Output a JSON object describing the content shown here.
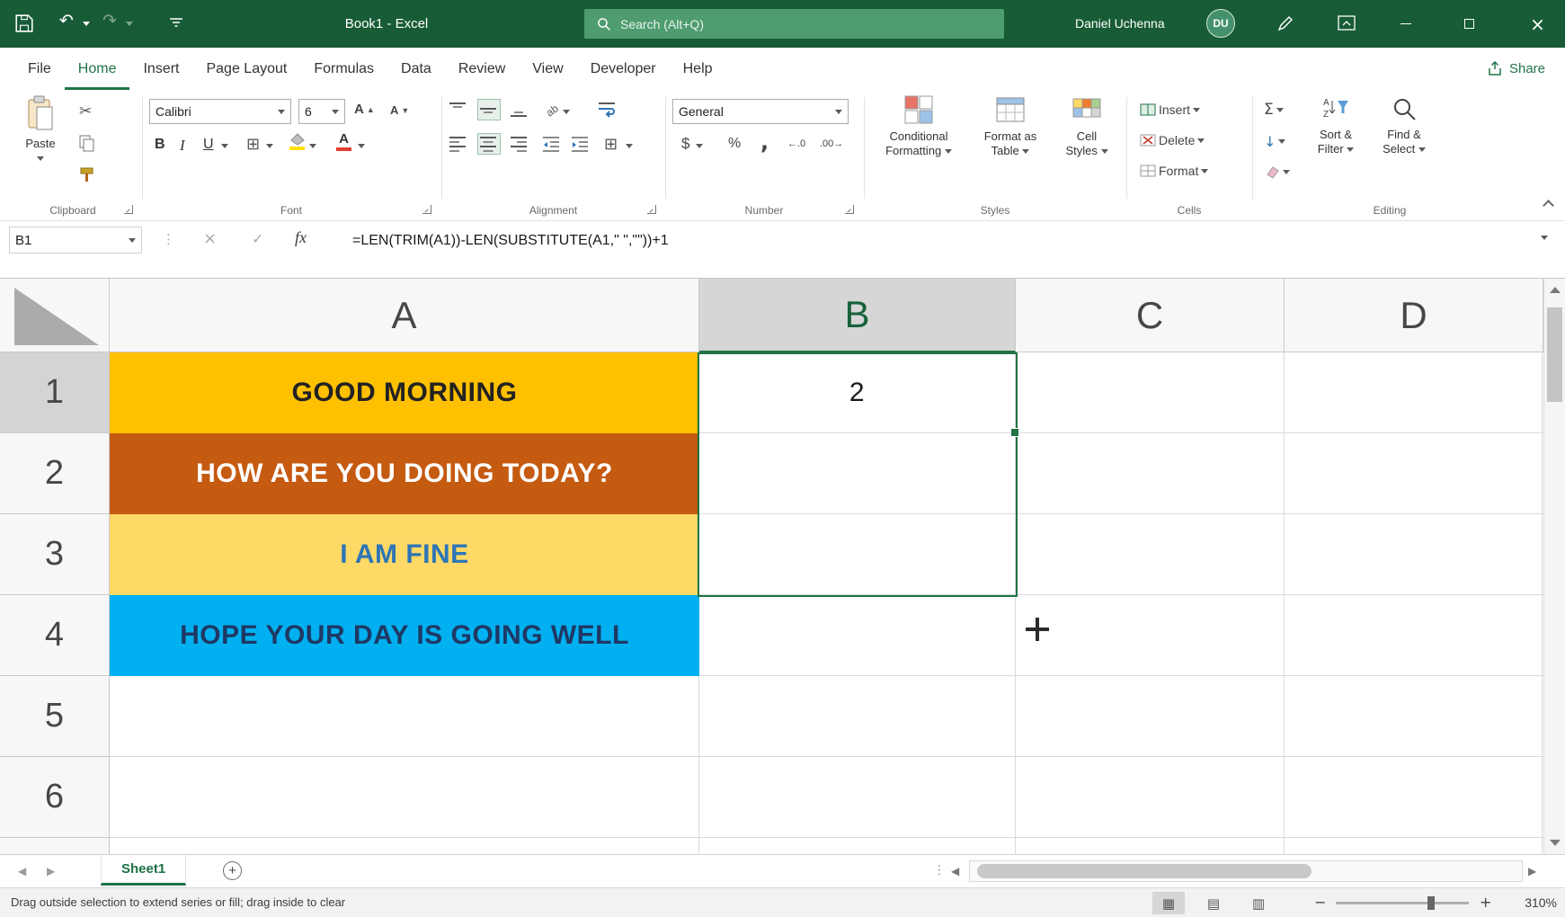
{
  "colors": {
    "titlebar_bg": "#185C37",
    "accent_green": "#217346",
    "search_bg": "#4E9C6F",
    "status_bg": "#F3F2F1"
  },
  "titlebar": {
    "title": "Book1 - Excel",
    "search_placeholder": "Search (Alt+Q)",
    "user_name": "Daniel Uchenna",
    "user_initials": "DU"
  },
  "menu": {
    "tabs": [
      "File",
      "Home",
      "Insert",
      "Page Layout",
      "Formulas",
      "Data",
      "Review",
      "View",
      "Developer",
      "Help"
    ],
    "active_tab": "Home",
    "share_label": "Share"
  },
  "ribbon": {
    "clipboard": {
      "paste_label": "Paste",
      "group_label": "Clipboard"
    },
    "font": {
      "family": "Calibri",
      "size": "6",
      "bold": "B",
      "italic": "I",
      "underline": "U",
      "group_label": "Font"
    },
    "alignment": {
      "group_label": "Alignment"
    },
    "number": {
      "format": "General",
      "dollar": "$",
      "percent": "%",
      "comma": ",",
      "group_label": "Number"
    },
    "styles": {
      "conditional_line1": "Conditional",
      "conditional_line2": "Formatting",
      "table_line1": "Format as",
      "table_line2": "Table",
      "cellstyles_line1": "Cell",
      "cellstyles_line2": "Styles",
      "group_label": "Styles"
    },
    "cells": {
      "insert_label": "Insert",
      "delete_label": "Delete",
      "format_label": "Format",
      "group_label": "Cells"
    },
    "editing": {
      "autosum": "Σ",
      "sort_line1": "Sort &",
      "sort_line2": "Filter",
      "find_line1": "Find &",
      "find_line2": "Select",
      "group_label": "Editing"
    }
  },
  "formula_bar": {
    "name_box": "B1",
    "cancel": "×",
    "enter": "✓",
    "fx": "fx",
    "formula": "=LEN(TRIM(A1))-LEN(SUBSTITUTE(A1,\" \",\"\"))+1"
  },
  "grid": {
    "columns": [
      "A",
      "B",
      "C",
      "D"
    ],
    "rows": [
      "1",
      "2",
      "3",
      "4",
      "5",
      "6"
    ],
    "cells": {
      "A1": {
        "text": "GOOD MORNING",
        "bg": "#FFC000",
        "color": "#222222"
      },
      "A2": {
        "text": "HOW ARE YOU DOING TODAY?",
        "bg": "#C55A11",
        "color": "#FFFFFF"
      },
      "A3": {
        "text": "I AM FINE",
        "bg": "#FFD966",
        "color": "#2E75B6"
      },
      "A4": {
        "text": "HOPE YOUR DAY IS GOING WELL",
        "bg": "#00B0F0",
        "color": "#1F3864"
      },
      "B1": {
        "text": "2",
        "bg": "#FFFFFF",
        "color": "#1A1A1A"
      }
    },
    "selection": {
      "range": "B1:B3",
      "active_cell": "B1"
    }
  },
  "sheet_tabs": {
    "active": "Sheet1"
  },
  "status_bar": {
    "message": "Drag outside selection to extend series or fill; drag inside to clear",
    "zoom": "310%"
  },
  "icons": {
    "undo": "↶",
    "redo": "↷",
    "cut": "✂",
    "borders": "⊞",
    "merge_center": "⊞",
    "grow_font": "A",
    "shrink_font": "A",
    "font_color_letter": "A",
    "inc_decimal": "←.0",
    "dec_decimal": ".00→",
    "fill_down": "↓",
    "dots": "⋮",
    "prev": "◀",
    "next": "▶",
    "new_sheet": "+",
    "view_normal": "▦",
    "view_layout": "▤",
    "view_break": "▥",
    "zoom_out": "−",
    "zoom_in": "+",
    "close": "×"
  }
}
